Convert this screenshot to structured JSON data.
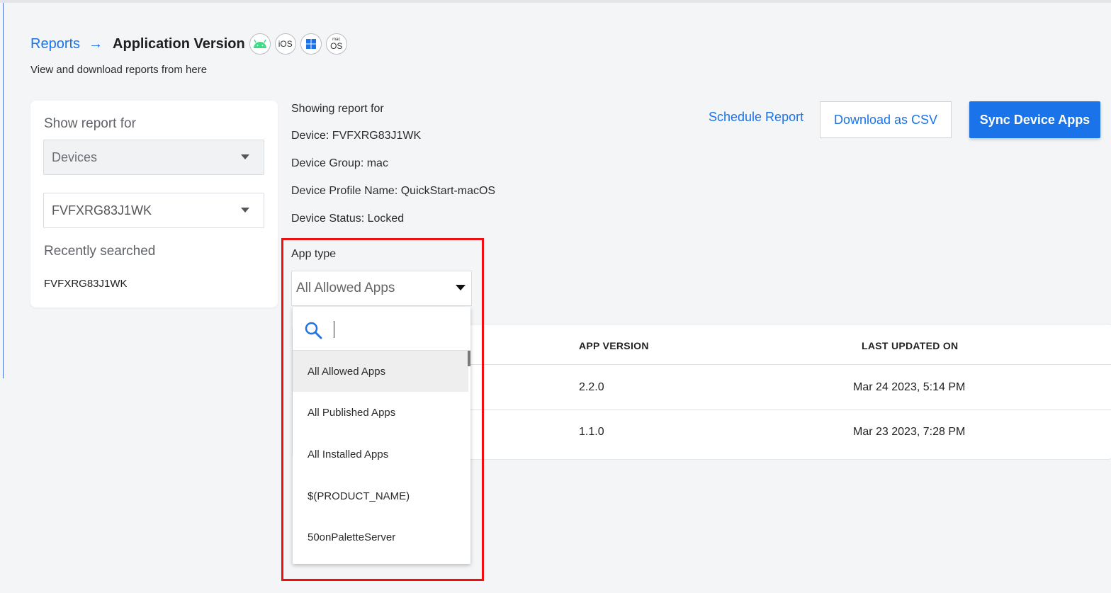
{
  "breadcrumb": {
    "root": "Reports",
    "arrow": "→",
    "current": "Application Version"
  },
  "os_icons": [
    {
      "name": "android-icon",
      "label": ""
    },
    {
      "name": "ios-icon",
      "label": "iOS"
    },
    {
      "name": "windows-icon",
      "label": ""
    },
    {
      "name": "macos-icon",
      "label_top": "mac",
      "label_bottom": "OS"
    }
  ],
  "subtitle": "View and download reports from here",
  "left_panel": {
    "show_report_label": "Show report for",
    "report_type_value": "Devices",
    "device_value": "FVFXRG83J1WK",
    "recent_label": "Recently searched",
    "recent_items": [
      "FVFXRG83J1WK"
    ]
  },
  "info": {
    "showing": "Showing report for",
    "device": "Device: FVFXRG83J1WK",
    "group": "Device Group: mac",
    "profile": "Device Profile Name: QuickStart-macOS",
    "status": "Device Status: Locked"
  },
  "actions": {
    "schedule": "Schedule Report",
    "download": "Download as CSV",
    "sync": "Sync Device Apps"
  },
  "table": {
    "columns": [
      "APP VERSION",
      "LAST UPDATED ON"
    ],
    "rows": [
      {
        "version": "2.2.0",
        "updated": "Mar 24 2023, 5:14 PM"
      },
      {
        "version": "1.1.0",
        "updated": "Mar 23 2023, 7:28 PM"
      }
    ]
  },
  "app_type": {
    "label": "App type",
    "selected": "All Allowed Apps",
    "search_value": "",
    "options": [
      "All Allowed Apps",
      "All Published Apps",
      "All Installed Apps",
      "$(PRODUCT_NAME)",
      "50onPaletteServer"
    ]
  },
  "colors": {
    "accent": "#1a73e8",
    "highlight": "#ee1010",
    "android": "#3ddc84",
    "windows": "#1a73e8"
  }
}
